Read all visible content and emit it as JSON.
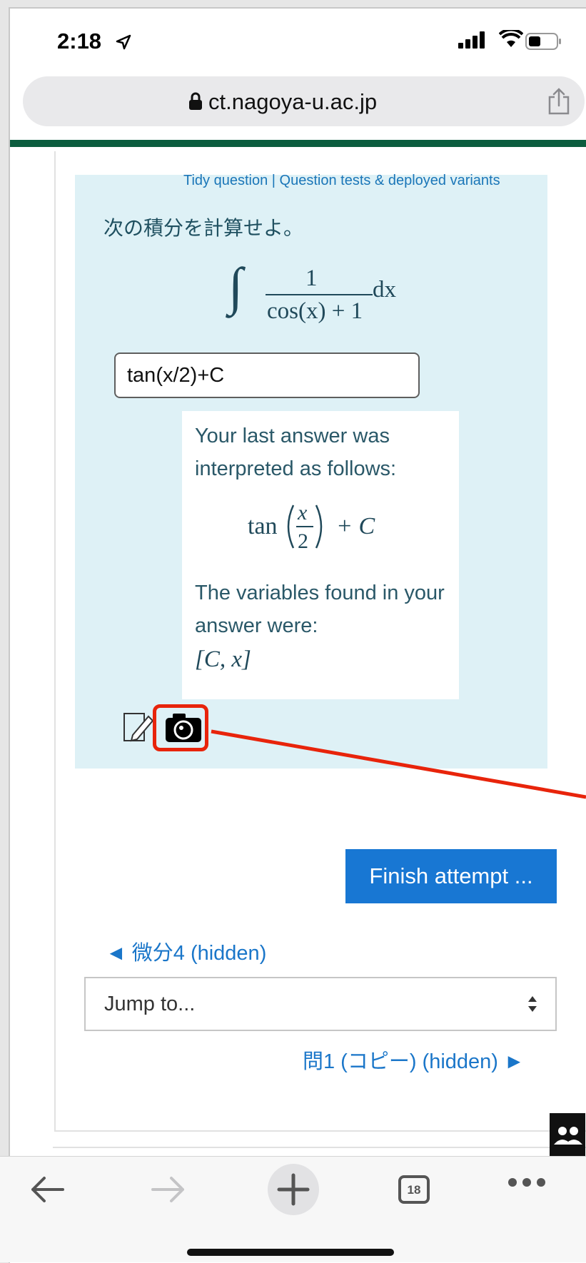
{
  "status_bar": {
    "time": "2:18"
  },
  "browser": {
    "url": "ct.nagoya-u.ac.jp",
    "tab_count": "18"
  },
  "question": {
    "admin_links": {
      "tidy": "Tidy question",
      "separator": "|",
      "tests": "Question tests & deployed variants"
    },
    "prompt": "次の積分を計算せよ。",
    "formula": {
      "integral": "∫",
      "numerator": "1",
      "denominator": "cos(x) + 1",
      "differential": "dx"
    },
    "answer_value": "tan(x/2)+C"
  },
  "feedback": {
    "interpreted_text": "Your last answer was interpreted as follows:",
    "interpreted_math": {
      "func": "tan",
      "num": "x",
      "den": "2",
      "tail": "+ C"
    },
    "variables_text": "The variables found in your answer were:",
    "variables_value": "[C, x]"
  },
  "navigation": {
    "finish_button": "Finish attempt ...",
    "prev_link": "◄ 微分4 (hidden)",
    "jump_placeholder": "Jump to...",
    "next_link": "問1 (コピー) (hidden) ►"
  },
  "colors": {
    "accent": "#1877d3",
    "link": "#1a76c9",
    "question_bg": "#def1f6",
    "highlight": "#e8240b",
    "brand_bar": "#0c5d3f"
  },
  "icons": [
    "location-arrow-icon",
    "signal-icon",
    "wifi-icon",
    "battery-icon",
    "lock-icon",
    "share-icon",
    "edit-icon",
    "camera-icon",
    "people-icon",
    "back-icon",
    "forward-icon",
    "new-tab-icon",
    "tabs-icon",
    "more-icon"
  ]
}
